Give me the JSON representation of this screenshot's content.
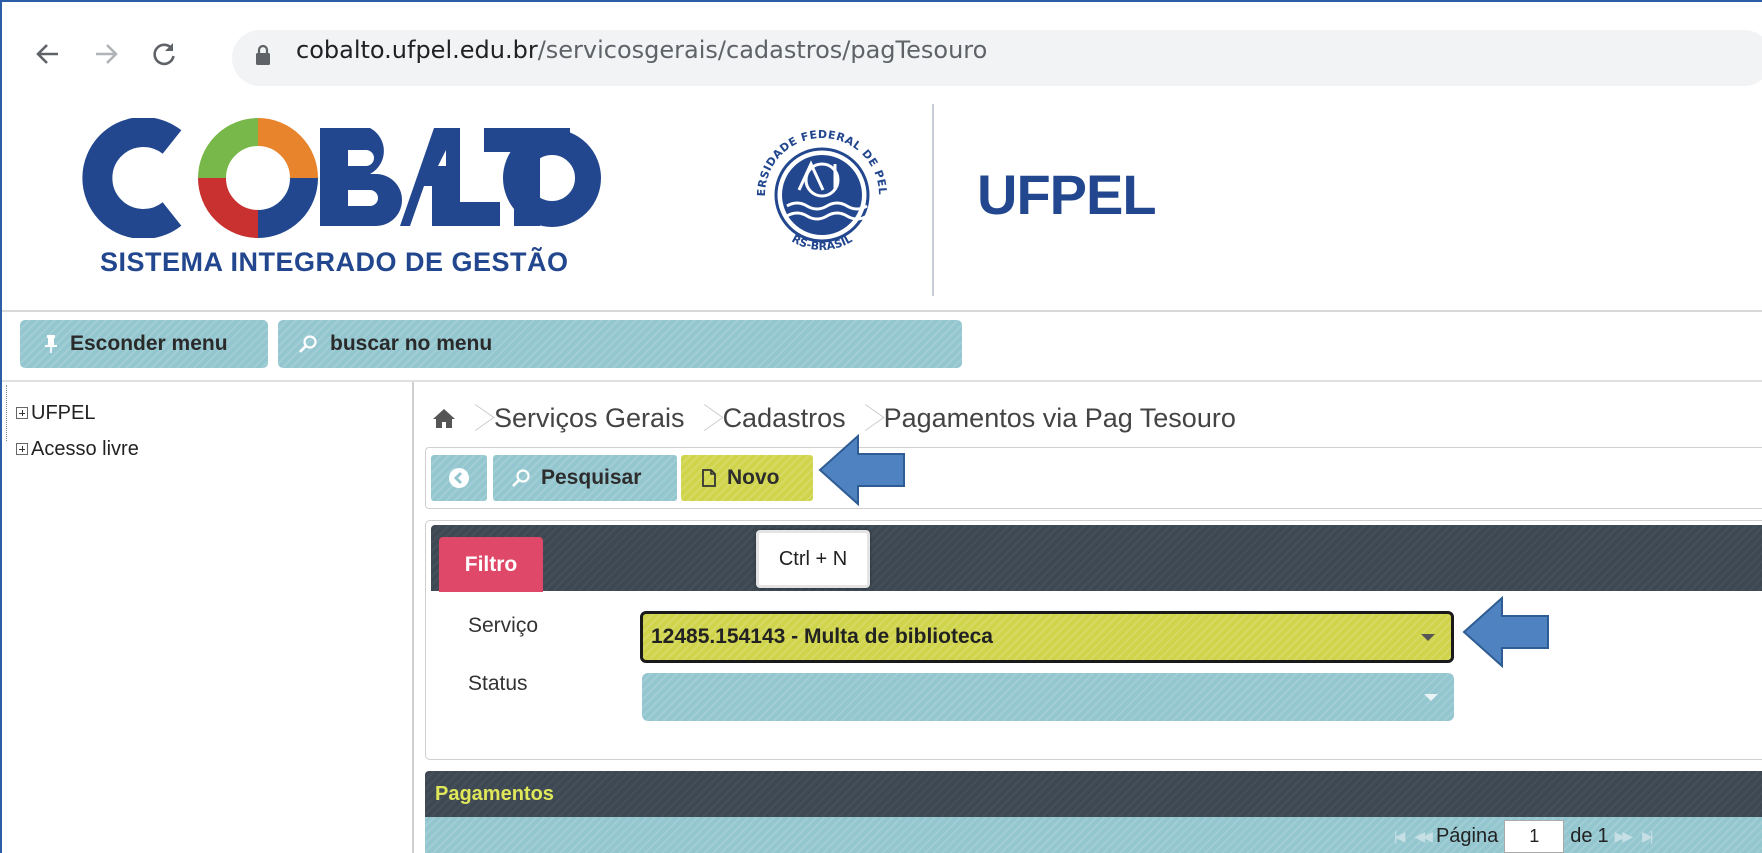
{
  "browser": {
    "url_host": "cobalto.ufpel.edu.br",
    "url_path": "/servicosgerais/cadastros/pagTesouro"
  },
  "header": {
    "logo_word": "COBALTO",
    "logo_subtitle": "SISTEMA INTEGRADO DE GESTÃO",
    "seal_text_top": "UNIVERSIDADE FEDERAL DE PELOTAS",
    "seal_text_bottom": "RS-BRASIL",
    "institution": "UFPEL"
  },
  "menu": {
    "hide_label": "Esconder menu",
    "search_label": "buscar no menu"
  },
  "sidebar": {
    "items": [
      {
        "label": "UFPEL"
      },
      {
        "label": "Acesso livre"
      }
    ]
  },
  "breadcrumb": {
    "items": [
      "Serviços Gerais",
      "Cadastros",
      "Pagamentos via Pag Tesouro"
    ]
  },
  "toolbar": {
    "search_label": "Pesquisar",
    "new_label": "Novo",
    "new_shortcut": "Ctrl + N"
  },
  "filter": {
    "tab_label": "Filtro",
    "servico_label": "Serviço",
    "servico_value": "12485.154143 - Multa de biblioteca",
    "status_label": "Status",
    "status_value": ""
  },
  "payments": {
    "title": "Pagamentos",
    "page_label": "Página",
    "page_value": "1",
    "of_label": "de",
    "total_pages": "1"
  },
  "colors": {
    "brand_blue": "#22478e",
    "teal": "#93c6cf",
    "highlight_yellow": "#cfd44a",
    "panel_dark": "#3d4852",
    "tab_pink": "#e0486a",
    "arrow_blue": "#4f82c0"
  }
}
